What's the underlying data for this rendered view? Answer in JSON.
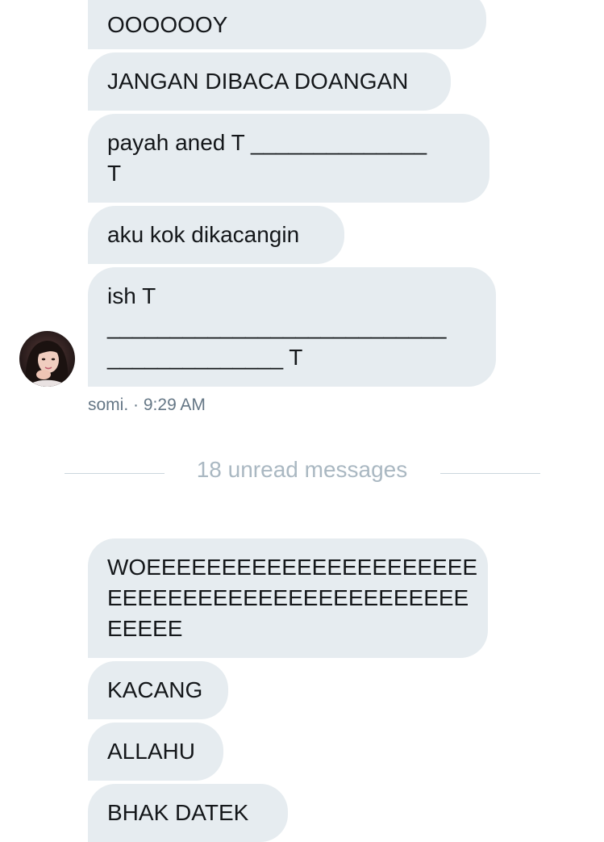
{
  "conversation": {
    "group1": [
      {
        "lines": [
          "OOOOOOY"
        ]
      },
      {
        "lines": [
          "JANGAN DIBACA DOANGAN"
        ]
      },
      {
        "lines": [
          "payah aned T ______________",
          "T"
        ]
      },
      {
        "lines": [
          "aku kok dikacangin"
        ]
      },
      {
        "lines": [
          "ish T",
          "___________________________",
          "______________ T"
        ]
      }
    ],
    "sender": {
      "name": "somi.",
      "separator": "·",
      "time": "9:29 AM"
    },
    "unread_divider": "18 unread messages",
    "group2": [
      {
        "lines": [
          "WOEEEEEEEEEEEEEEEEEEEEEE",
          "EEEEEEEEEEEEEEEEEEEEEEEE",
          "EEEEE"
        ]
      },
      {
        "lines": [
          "KACANG"
        ]
      },
      {
        "lines": [
          "ALLAHU"
        ]
      },
      {
        "lines": [
          "BHAK DATEK"
        ]
      }
    ]
  },
  "colors": {
    "bubble": "#e6ecf0",
    "text": "#14171a",
    "meta": "#657786",
    "divider_text": "#aab8c2",
    "divider_line": "#ccd6dd"
  }
}
